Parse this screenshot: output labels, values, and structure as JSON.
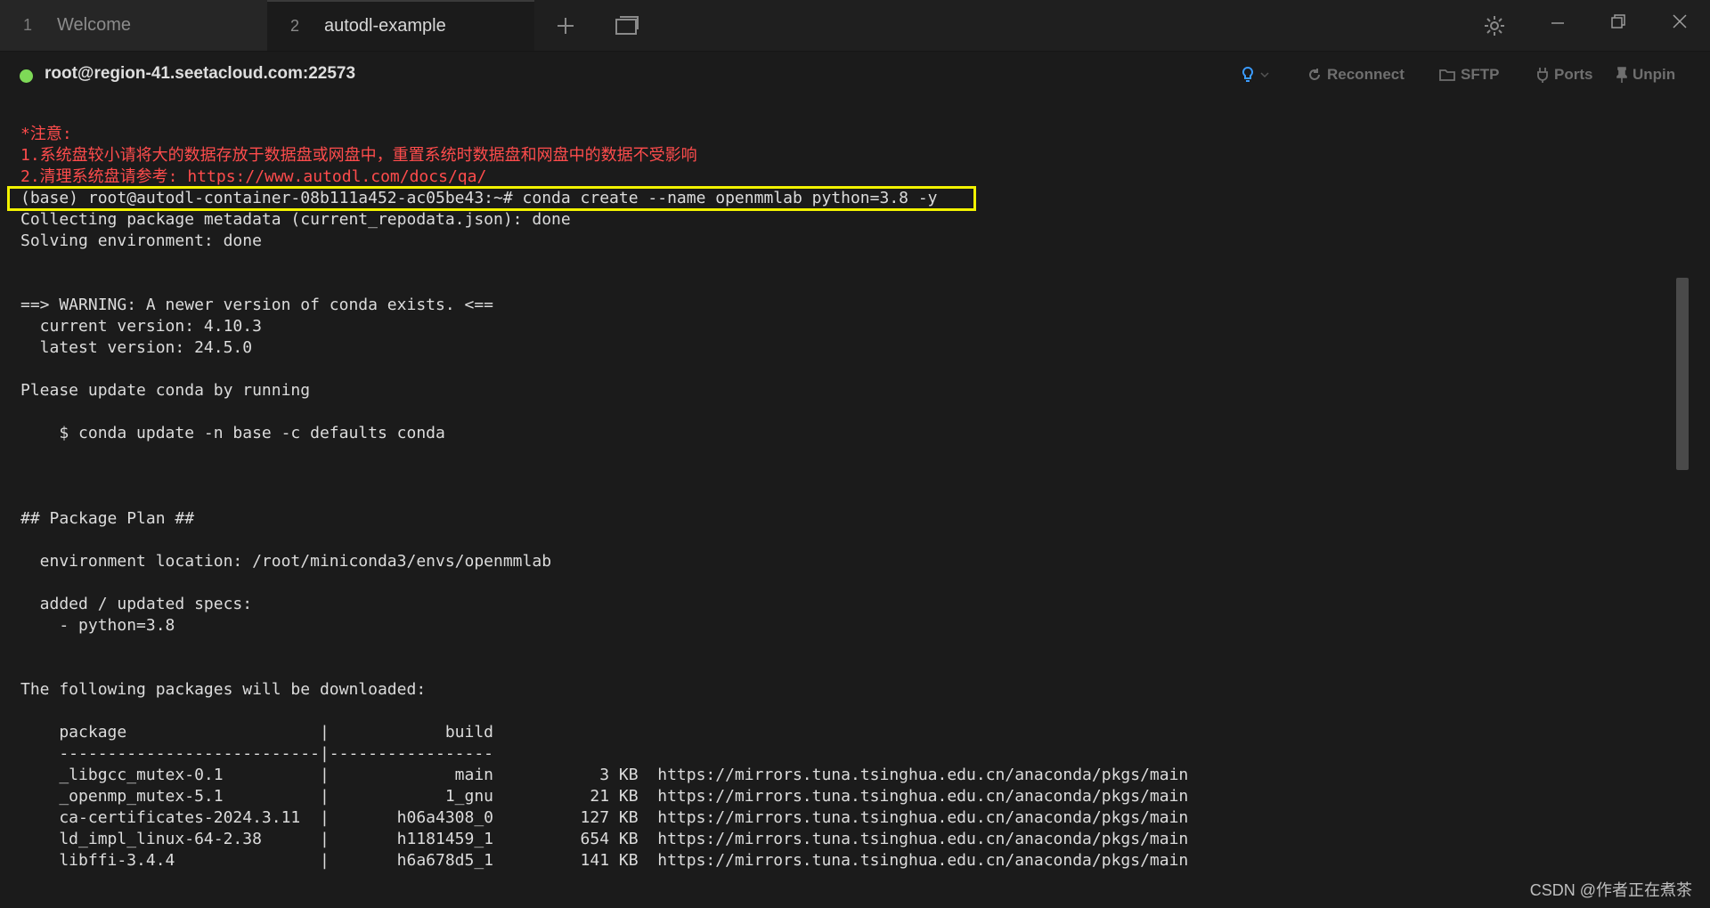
{
  "tabs": [
    {
      "num": "1",
      "label": "Welcome"
    },
    {
      "num": "2",
      "label": "autodl-example"
    }
  ],
  "tabbar_icons": [
    "plus-icon",
    "window-icon",
    "gear-icon",
    "minimize-icon",
    "restore-icon",
    "close-icon"
  ],
  "status": {
    "host": "root@region-41.seetacloud.com:22573",
    "buttons": [
      {
        "name": "reconnect",
        "label": "Reconnect",
        "icon": "refresh-icon"
      },
      {
        "name": "sftp",
        "label": "SFTP",
        "icon": "folder-icon"
      },
      {
        "name": "ports",
        "label": "Ports",
        "icon": "plug-icon"
      },
      {
        "name": "unpin",
        "label": "Unpin",
        "icon": "pin-icon"
      }
    ]
  },
  "terminal": {
    "lines": [
      {
        "text": "*注意:",
        "style": "red"
      },
      {
        "text": "1.系统盘较小请将大的数据存放于数据盘或网盘中，重置系统时数据盘和网盘中的数据不受影响",
        "style": "red"
      },
      {
        "text": "2.清理系统盘请参考: https://www.autodl.com/docs/qa/",
        "style": "red"
      },
      {
        "text": "(base) root@autodl-container-08b111a452-ac05be43:~# conda create --name openmmlab python=3.8 -y",
        "style": "normal"
      },
      {
        "text": "Collecting package metadata (current_repodata.json): done",
        "style": "normal"
      },
      {
        "text": "Solving environment: done",
        "style": "normal"
      },
      {
        "text": "",
        "style": "normal"
      },
      {
        "text": "",
        "style": "normal"
      },
      {
        "text": "==> WARNING: A newer version of conda exists. <==",
        "style": "normal"
      },
      {
        "text": "  current version: 4.10.3",
        "style": "normal"
      },
      {
        "text": "  latest version: 24.5.0",
        "style": "normal"
      },
      {
        "text": "",
        "style": "normal"
      },
      {
        "text": "Please update conda by running",
        "style": "normal"
      },
      {
        "text": "",
        "style": "normal"
      },
      {
        "text": "    $ conda update -n base -c defaults conda",
        "style": "normal"
      },
      {
        "text": "",
        "style": "normal"
      },
      {
        "text": "",
        "style": "normal"
      },
      {
        "text": "",
        "style": "normal"
      },
      {
        "text": "## Package Plan ##",
        "style": "normal"
      },
      {
        "text": "",
        "style": "normal"
      },
      {
        "text": "  environment location: /root/miniconda3/envs/openmmlab",
        "style": "normal"
      },
      {
        "text": "",
        "style": "normal"
      },
      {
        "text": "  added / updated specs:",
        "style": "normal"
      },
      {
        "text": "    - python=3.8",
        "style": "normal"
      },
      {
        "text": "",
        "style": "normal"
      },
      {
        "text": "",
        "style": "normal"
      },
      {
        "text": "The following packages will be downloaded:",
        "style": "normal"
      },
      {
        "text": "",
        "style": "normal"
      },
      {
        "text": "    package                    |            build",
        "style": "normal"
      },
      {
        "text": "    ---------------------------|-----------------",
        "style": "normal"
      },
      {
        "text": "    _libgcc_mutex-0.1          |             main           3 KB  https://mirrors.tuna.tsinghua.edu.cn/anaconda/pkgs/main",
        "style": "normal"
      },
      {
        "text": "    _openmp_mutex-5.1          |            1_gnu          21 KB  https://mirrors.tuna.tsinghua.edu.cn/anaconda/pkgs/main",
        "style": "normal"
      },
      {
        "text": "    ca-certificates-2024.3.11  |       h06a4308_0         127 KB  https://mirrors.tuna.tsinghua.edu.cn/anaconda/pkgs/main",
        "style": "normal"
      },
      {
        "text": "    ld_impl_linux-64-2.38      |       h1181459_1         654 KB  https://mirrors.tuna.tsinghua.edu.cn/anaconda/pkgs/main",
        "style": "normal"
      },
      {
        "text": "    libffi-3.4.4               |       h6a678d5_1         141 KB  https://mirrors.tuna.tsinghua.edu.cn/anaconda/pkgs/main",
        "style": "normal"
      }
    ]
  },
  "watermark": "CSDN @作者正在煮茶"
}
